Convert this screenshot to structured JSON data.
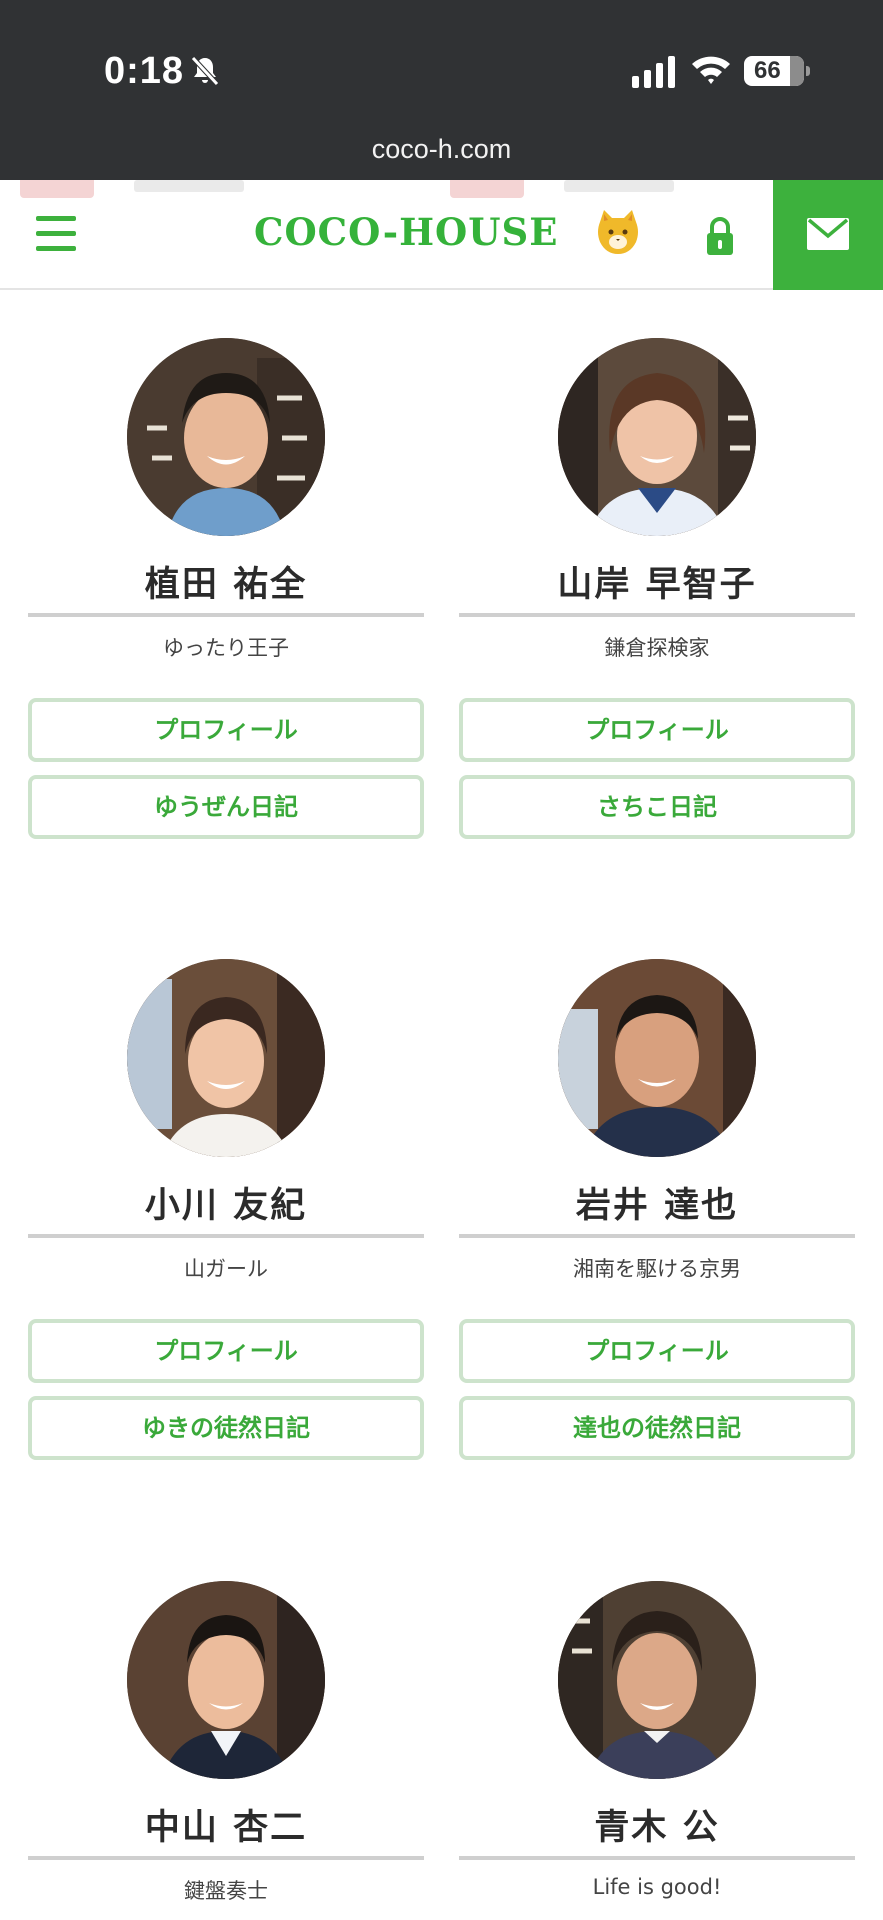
{
  "status_bar": {
    "time": "0:18",
    "battery": "66"
  },
  "browser": {
    "url": "coco-h.com"
  },
  "header": {
    "logo": "COCO-HOUSE"
  },
  "staff": [
    {
      "name": "植田 祐全",
      "nickname": "ゆったり王子",
      "profile_label": "プロフィール",
      "diary_label": "ゆうぜん日記"
    },
    {
      "name": "山岸 早智子",
      "nickname": "鎌倉探検家",
      "profile_label": "プロフィール",
      "diary_label": "さちこ日記"
    },
    {
      "name": "小川 友紀",
      "nickname": "山ガール",
      "profile_label": "プロフィール",
      "diary_label": "ゆきの徒然日記"
    },
    {
      "name": "岩井 達也",
      "nickname": "湘南を駆ける京男",
      "profile_label": "プロフィール",
      "diary_label": "達也の徒然日記"
    },
    {
      "name": "中山 杏二",
      "nickname": "鍵盤奏士"
    },
    {
      "name": "青木 公",
      "nickname": "Life is good!"
    }
  ],
  "colors": {
    "brand_green": "#3db13d",
    "button_border": "#cde3cc",
    "status_bar_bg": "#303234"
  }
}
